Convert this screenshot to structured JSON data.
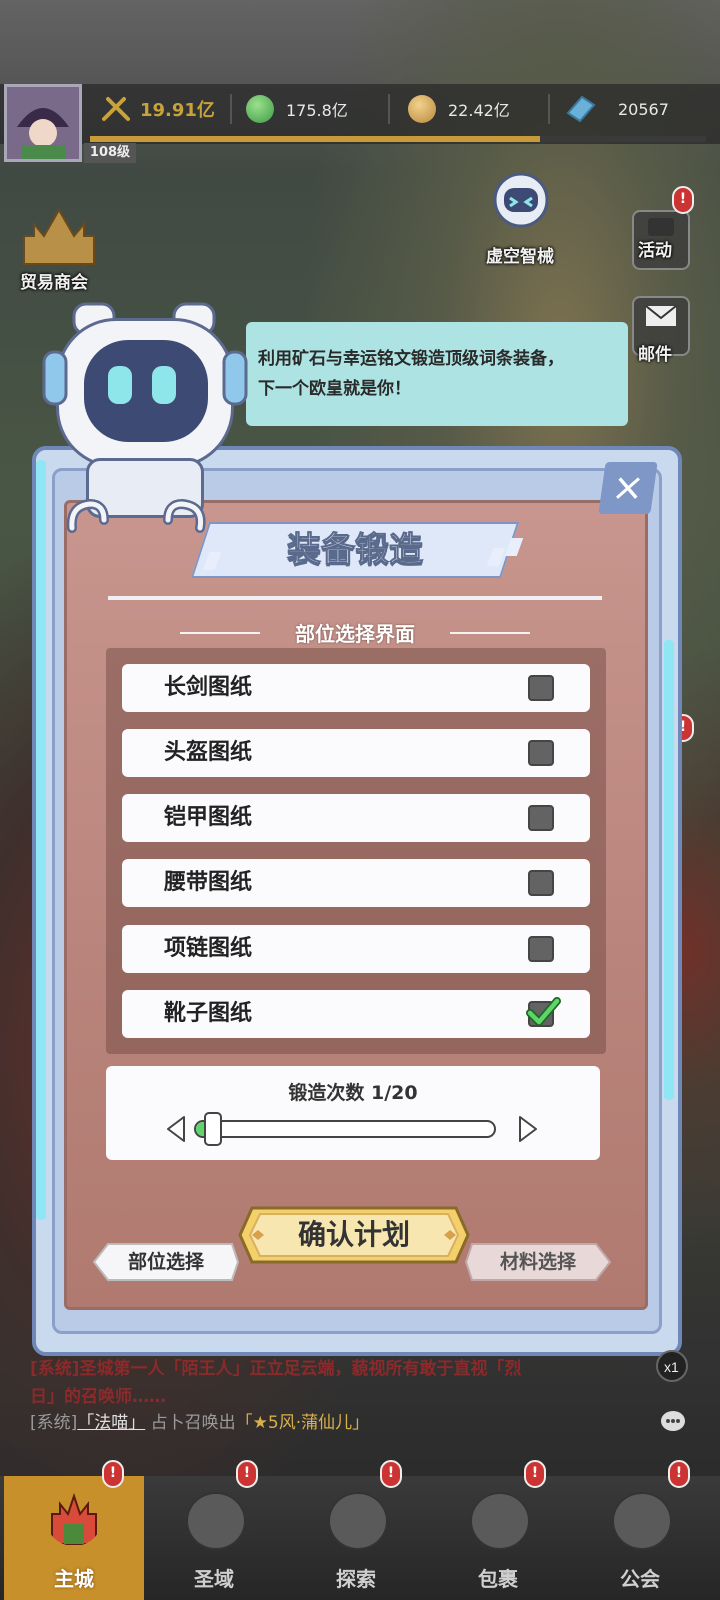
{
  "player": {
    "level": "108级"
  },
  "resources": [
    {
      "name": "power",
      "icon": "swords-icon",
      "value": "19.91亿",
      "color": "#c8a23a"
    },
    {
      "name": "green-gem",
      "icon": "green-orb-icon",
      "value": "175.8亿",
      "color": "#59b85a"
    },
    {
      "name": "gold",
      "icon": "gold-coin-icon",
      "value": "22.42亿",
      "color": "#c99a4a"
    },
    {
      "name": "diamond",
      "icon": "blue-crystal-icon",
      "value": "20567",
      "color": "#6ab0d8"
    }
  ],
  "scene": {
    "trade_guild": "贸易商会",
    "void_mech": "虚空智械",
    "right_menu": {
      "activity": "活动",
      "mail": "邮件"
    }
  },
  "bubble": {
    "line1": "利用矿石与幸运铭文锻造顶级词条装备，",
    "line2": "下一个欧皇就是你！"
  },
  "panel": {
    "title": "装备锻造",
    "subtitle": "部位选择界面",
    "items": [
      {
        "label": "长剑图纸",
        "checked": false
      },
      {
        "label": "头盔图纸",
        "checked": false
      },
      {
        "label": "铠甲图纸",
        "checked": false
      },
      {
        "label": "腰带图纸",
        "checked": false
      },
      {
        "label": "项链图纸",
        "checked": false
      },
      {
        "label": "靴子图纸",
        "checked": true
      }
    ],
    "forge_count_label": "锻造次数 1/20",
    "forge_count": {
      "current": 1,
      "max": 20
    },
    "confirm": "确认计划",
    "part_select": "部位选择",
    "material_select": "材料选择"
  },
  "chat": {
    "line1a": "[系统]圣城第一人「陌王人」正立足云端，藐视所有敢于直视「烈",
    "line1b": "日」的召唤师……",
    "line2_prefix": "[系统]",
    "line2_name": "「法喵」",
    "line2_mid": "占卜召唤出",
    "line2_item": "「★5风·蒲仙儿」"
  },
  "nav": [
    {
      "label": "主城",
      "active": true
    },
    {
      "label": "圣域",
      "active": false
    },
    {
      "label": "探索",
      "active": false
    },
    {
      "label": "包裹",
      "active": false
    },
    {
      "label": "公会",
      "active": false
    }
  ],
  "colors": {
    "accent_green": "#5fd46a",
    "panel_frame": "#c9d9ee",
    "panel_inner": "#b8837a",
    "gold_button": "#f4d06a"
  }
}
